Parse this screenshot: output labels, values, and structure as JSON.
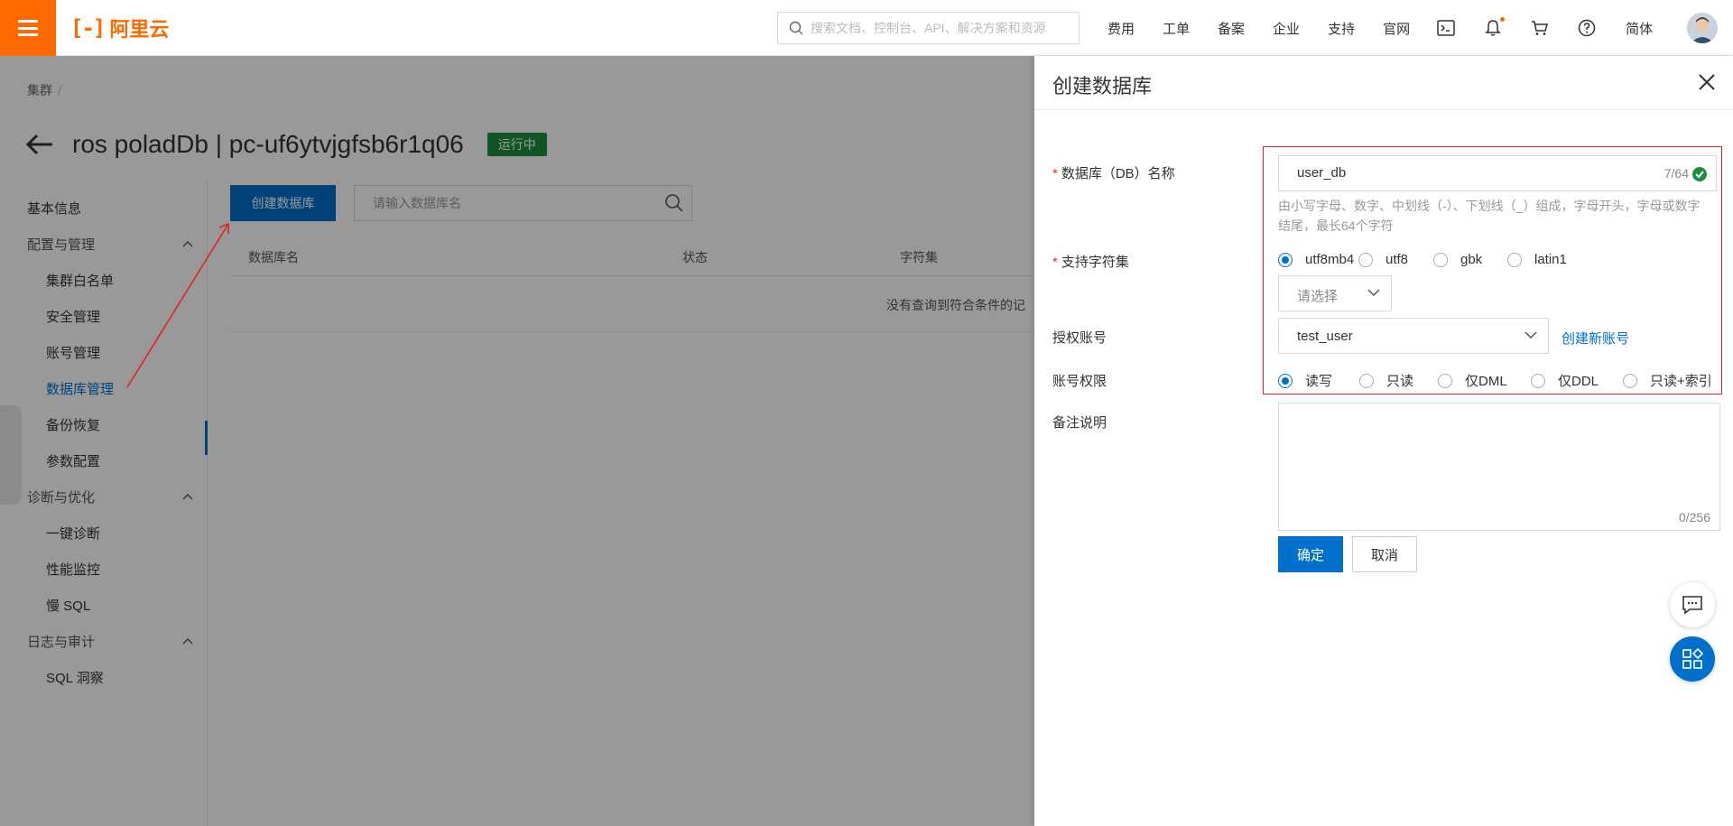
{
  "colors": {
    "brand": "#ff6a00",
    "primary": "#0070cc",
    "success": "#1e8e3e",
    "highlight": "#e0222a"
  },
  "topbar": {
    "logo_mark": "[-]",
    "logo_text": "阿里云",
    "search_placeholder": "搜索文档、控制台、API、解决方案和资源",
    "nav": [
      "费用",
      "工单",
      "备案",
      "企业",
      "支持",
      "官网"
    ],
    "icons": [
      "terminal-icon",
      "bell-icon",
      "cart-icon",
      "help-icon"
    ],
    "lang": "简体"
  },
  "page": {
    "breadcrumb": "集群",
    "breadcrumb_sep": "/",
    "title": "ros poladDb | pc-uf6ytvjgfsb6r1q06",
    "status": "运行中"
  },
  "sidenav": {
    "basic": "基本信息",
    "group1": "配置与管理",
    "whitelist": "集群白名单",
    "security": "安全管理",
    "account": "账号管理",
    "database": "数据库管理",
    "backup": "备份恢复",
    "params": "参数配置",
    "group2": "诊断与优化",
    "diagnose": "一键诊断",
    "monitor": "性能监控",
    "slowsql": "慢 SQL",
    "group3": "日志与审计",
    "sqlinsight": "SQL 洞察"
  },
  "list": {
    "create_btn": "创建数据库",
    "search_placeholder": "请输入数据库名",
    "col_name": "数据库名",
    "col_status": "状态",
    "col_charset": "字符集",
    "empty": "没有查询到符合条件的记"
  },
  "drawer": {
    "title": "创建数据库",
    "name_label": "数据库（DB）名称",
    "name_value": "user_db",
    "name_count": "7/64",
    "name_hint": "由小写字母、数字、中划线（-）、下划线（_）组成，字母开头，字母或数字结尾，最长64个字符",
    "charset_label": "支持字符集",
    "charsets": [
      "utf8mb4",
      "utf8",
      "gbk",
      "latin1"
    ],
    "charset_selected": "utf8mb4",
    "charset_other": "请选择",
    "account_label": "授权账号",
    "account_value": "test_user",
    "create_account": "创建新账号",
    "perm_label": "账号权限",
    "perms": [
      "读写",
      "只读",
      "仅DML",
      "仅DDL",
      "只读+索引"
    ],
    "perm_selected": "读写",
    "remark_label": "备注说明",
    "remark_count": "0/256",
    "ok": "确定",
    "cancel": "取消"
  }
}
